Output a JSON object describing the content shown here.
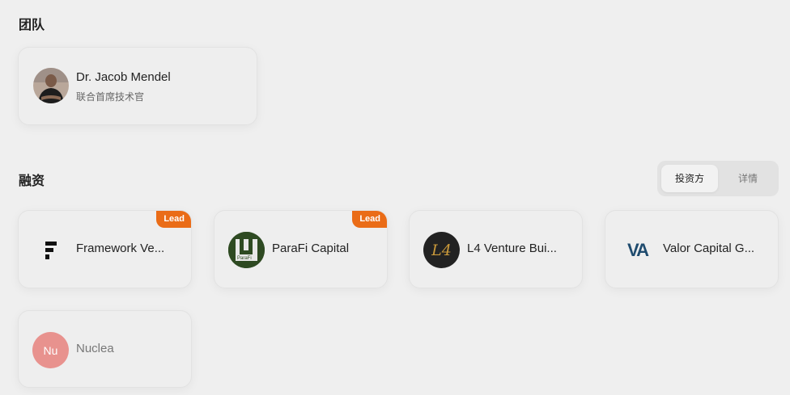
{
  "team": {
    "title": "团队",
    "members": [
      {
        "name": "Dr. Jacob Mendel",
        "role": "联合首席技术官"
      }
    ]
  },
  "funding": {
    "title": "融资",
    "tabs": [
      {
        "label": "投资方",
        "active": true
      },
      {
        "label": "详情",
        "active": false
      }
    ],
    "investors": [
      {
        "name": "Framework Ve...",
        "lead": true,
        "badge": "Lead",
        "logo": "framework-logo"
      },
      {
        "name": "ParaFi Capital",
        "lead": true,
        "badge": "Lead",
        "logo": "parafi-logo",
        "logo_text": "ParaFi"
      },
      {
        "name": "L4 Venture Bui...",
        "lead": false,
        "logo": "l4-logo",
        "logo_text": "L4"
      },
      {
        "name": "Valor Capital G...",
        "lead": false,
        "logo": "valor-logo",
        "logo_text": "VA"
      },
      {
        "name": "Nuclea",
        "lead": false,
        "logo": "initials-avatar",
        "logo_text": "Nu"
      }
    ]
  },
  "colors": {
    "lead_badge": "#ea6c17",
    "nu_avatar": "#e8928e",
    "valor_blue": "#1f4b6e",
    "parafi_green": "#2e4a22",
    "l4_gold": "#c8983a"
  }
}
